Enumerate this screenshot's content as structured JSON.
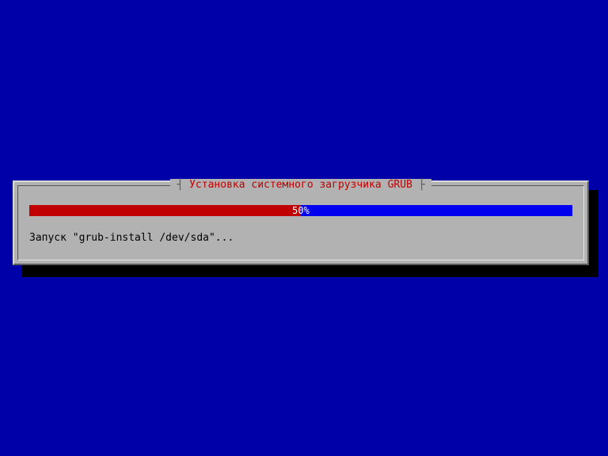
{
  "dialog": {
    "title": "Установка системного загрузчика GRUB",
    "progress": {
      "percent": 50,
      "label": "50%",
      "fill_width": "50%"
    },
    "status": "Запуск \"grub-install /dev/sda\"..."
  }
}
